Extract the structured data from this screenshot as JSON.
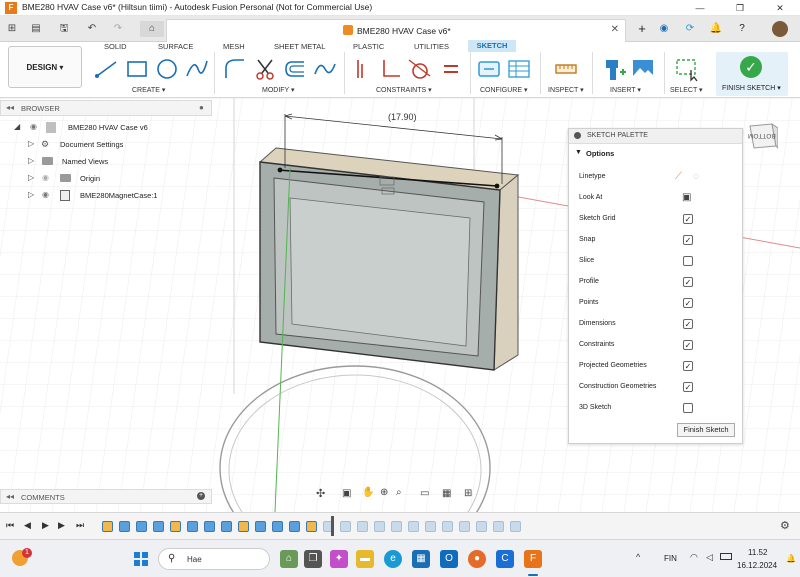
{
  "window": {
    "title": "BME280 HVAV Case v6* (Hiltsun tiimi) - Autodesk Fusion Personal (Not for Commercial Use)"
  },
  "document_tab": {
    "label": "BME280 HVAV Case v6*"
  },
  "ribbon": {
    "workspace_button": "DESIGN ▾",
    "tabs": [
      "SOLID",
      "SURFACE",
      "MESH",
      "SHEET METAL",
      "PLASTIC",
      "UTILITIES",
      "SKETCH"
    ],
    "active_tab": "SKETCH",
    "groups": {
      "create": "CREATE ▾",
      "modify": "MODIFY ▾",
      "constraints": "CONSTRAINTS ▾",
      "configure": "CONFIGURE ▾",
      "inspect": "INSPECT ▾",
      "insert": "INSERT ▾",
      "select": "SELECT ▾",
      "finish_sketch": "FINISH SKETCH ▾"
    }
  },
  "browser": {
    "header": "BROWSER",
    "items": [
      {
        "label": "BME280 HVAV Case v6",
        "icon": "document-icon"
      },
      {
        "label": "Document Settings",
        "icon": "gear-icon"
      },
      {
        "label": "Named Views",
        "icon": "folder-icon"
      },
      {
        "label": "Origin",
        "icon": "folder-icon"
      },
      {
        "label": "BME280MagnetCase:1",
        "icon": "component-icon"
      }
    ]
  },
  "dimension": {
    "value": "(17.90)"
  },
  "viewcube": {
    "face_label": "BOTTOM"
  },
  "palette": {
    "header": "SKETCH PALETTE",
    "section": "Options",
    "rows": [
      {
        "label": "Linetype",
        "kind": "icons"
      },
      {
        "label": "Look At",
        "kind": "icon"
      },
      {
        "label": "Sketch Grid",
        "checked": true
      },
      {
        "label": "Snap",
        "checked": true
      },
      {
        "label": "Slice",
        "checked": false
      },
      {
        "label": "Profile",
        "checked": true
      },
      {
        "label": "Points",
        "checked": true
      },
      {
        "label": "Dimensions",
        "checked": true
      },
      {
        "label": "Constraints",
        "checked": true
      },
      {
        "label": "Projected Geometries",
        "checked": true
      },
      {
        "label": "Construction Geometries",
        "checked": true
      },
      {
        "label": "3D Sketch",
        "checked": false
      }
    ],
    "finish_button": "Finish Sketch"
  },
  "comments": {
    "header": "COMMENTS"
  },
  "taskbar": {
    "search_placeholder": "Hae",
    "language": "FIN",
    "time": "11.52",
    "date": "16.12.2024",
    "notification_count": "1"
  },
  "colors": {
    "accent": "#1a6fb4",
    "sketch_tab_bg": "#cfe6f7",
    "finish_green": "#36a84a",
    "model_body": "#9ea6a3",
    "model_top": "#d9d1bd"
  }
}
